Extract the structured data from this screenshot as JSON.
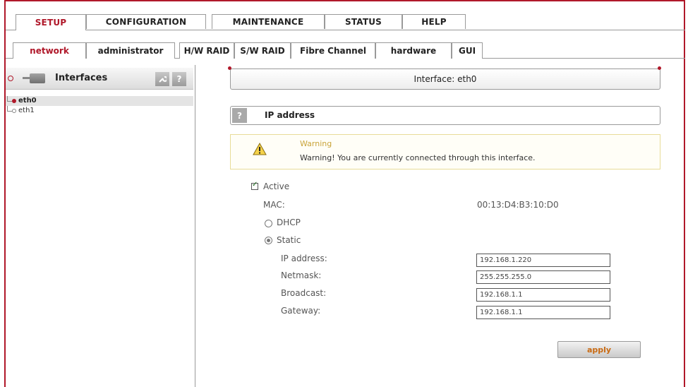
{
  "tabs_top": [
    {
      "label": "SETUP",
      "active": true
    },
    {
      "label": "CONFIGURATION",
      "active": false
    },
    {
      "label": "MAINTENANCE",
      "active": false
    },
    {
      "label": "STATUS",
      "active": false
    },
    {
      "label": "HELP",
      "active": false
    }
  ],
  "tabs_sub": [
    {
      "label": "network",
      "active": true
    },
    {
      "label": "administrator",
      "active": false
    },
    {
      "label": "H/W RAID",
      "active": false
    },
    {
      "label": "S/W RAID",
      "active": false
    },
    {
      "label": "Fibre Channel",
      "active": false
    },
    {
      "label": "hardware",
      "active": false
    },
    {
      "label": "GUI",
      "active": false
    }
  ],
  "left_panel": {
    "title": "Interfaces",
    "icon": "network-folder-icon",
    "tool_button": "wrench-icon",
    "help_button": "?",
    "tree": [
      {
        "label": "eth0",
        "selected": true
      },
      {
        "label": "eth1",
        "selected": false
      }
    ]
  },
  "header": {
    "title": "Interface: eth0"
  },
  "section": {
    "help": "?",
    "title": "IP address"
  },
  "warning": {
    "title": "Warning",
    "text": "Warning! You are currently connected through this interface.",
    "icon": "warning-triangle-icon"
  },
  "form": {
    "active_label": "Active",
    "active_checked": true,
    "mac_label": "MAC:",
    "mac_value": "00:13:D4:B3:10:D0",
    "dhcp_label": "DHCP",
    "static_label": "Static",
    "mode": "Static",
    "ip_label": "IP address:",
    "ip_value": "192.168.1.220",
    "netmask_label": "Netmask:",
    "netmask_value": "255.255.255.0",
    "broadcast_label": "Broadcast:",
    "broadcast_value": "192.168.1.1",
    "gateway_label": "Gateway:",
    "gateway_value": "192.168.1.1"
  },
  "apply_label": "apply",
  "colors": {
    "accent": "#b0182a",
    "apply_text": "#c96a12",
    "warning_border": "#e8dc98"
  }
}
